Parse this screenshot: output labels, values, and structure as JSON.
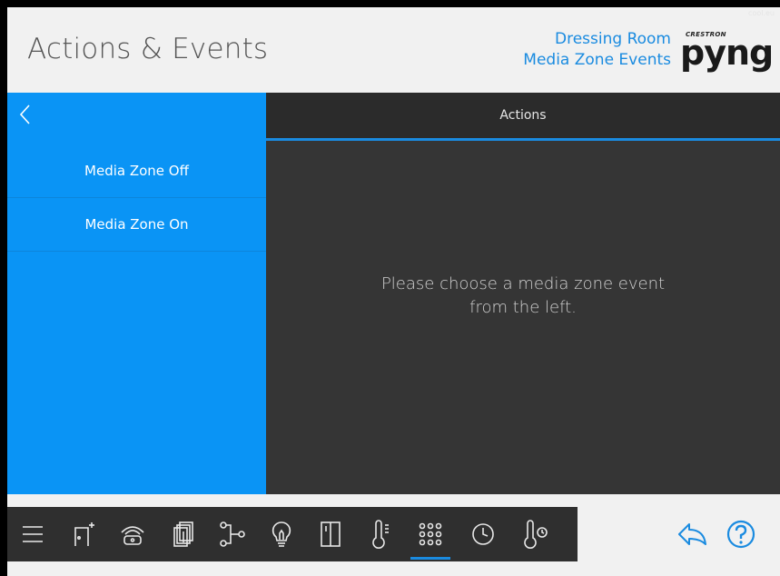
{
  "header": {
    "title": "Actions & Events",
    "room_line1": "Dressing Room",
    "room_line2": "Media Zone Events",
    "logo_brand": "CRESTRON",
    "logo_word": "pyng",
    "corner_text": "cool.eu"
  },
  "events": {
    "items": [
      {
        "label": "Media Zone Off"
      },
      {
        "label": "Media Zone On"
      }
    ]
  },
  "actions": {
    "tab_label": "Actions",
    "message_line1": "Please choose a media zone event",
    "message_line2": "from the left."
  },
  "toolbar": {
    "items": [
      {
        "icon": "menu-icon"
      },
      {
        "icon": "add-room-icon"
      },
      {
        "icon": "phone-icon"
      },
      {
        "icon": "shades-icon"
      },
      {
        "icon": "scenes-icon"
      },
      {
        "icon": "lightbulb-icon"
      },
      {
        "icon": "door-icon"
      },
      {
        "icon": "thermometer-icon"
      },
      {
        "icon": "keypad-icon",
        "active": true
      },
      {
        "icon": "clock-icon"
      },
      {
        "icon": "thermostat-icon"
      }
    ]
  },
  "colors": {
    "accent": "#1a8be0",
    "event_panel": "#0a94f5",
    "dark_panel": "#353535"
  }
}
